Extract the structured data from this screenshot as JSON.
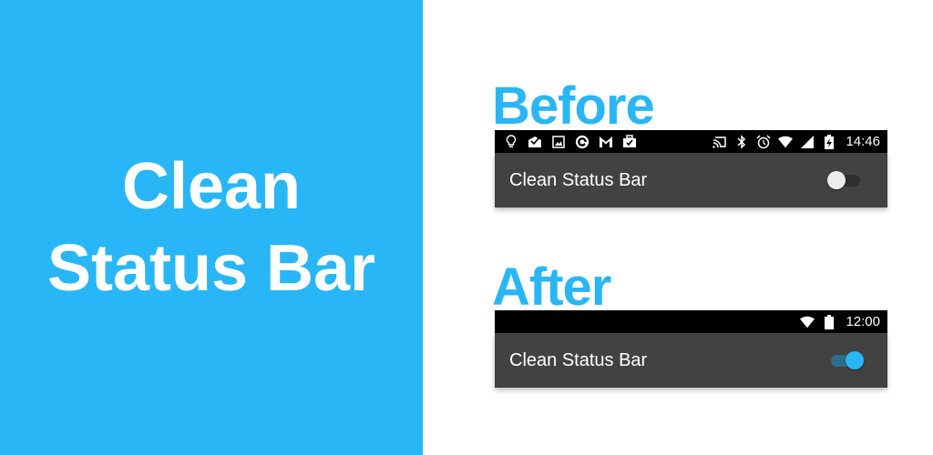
{
  "hero": {
    "title_line1": "Clean",
    "title_line2": "Status Bar",
    "background_color": "#29b6f6"
  },
  "before": {
    "label": "Before",
    "status_bar": {
      "notification_icons": [
        "lightbulb-icon",
        "mail-check-icon",
        "image-icon",
        "sync-refresh-icon",
        "gmail-icon",
        "briefcase-check-icon"
      ],
      "system_icons": [
        "cast-icon",
        "bluetooth-icon",
        "alarm-icon",
        "wifi-icon",
        "cell-signal-icon",
        "battery-charging-icon"
      ],
      "time": "14:46"
    },
    "toolbar": {
      "title": "Clean Status Bar",
      "toggle_state": "off"
    }
  },
  "after": {
    "label": "After",
    "status_bar": {
      "system_icons": [
        "wifi-icon",
        "battery-full-icon"
      ],
      "time": "12:00"
    },
    "toolbar": {
      "title": "Clean Status Bar",
      "toggle_state": "on"
    }
  },
  "colors": {
    "accent": "#29b6f6",
    "toolbar": "#424242",
    "status_bar": "#000000"
  }
}
